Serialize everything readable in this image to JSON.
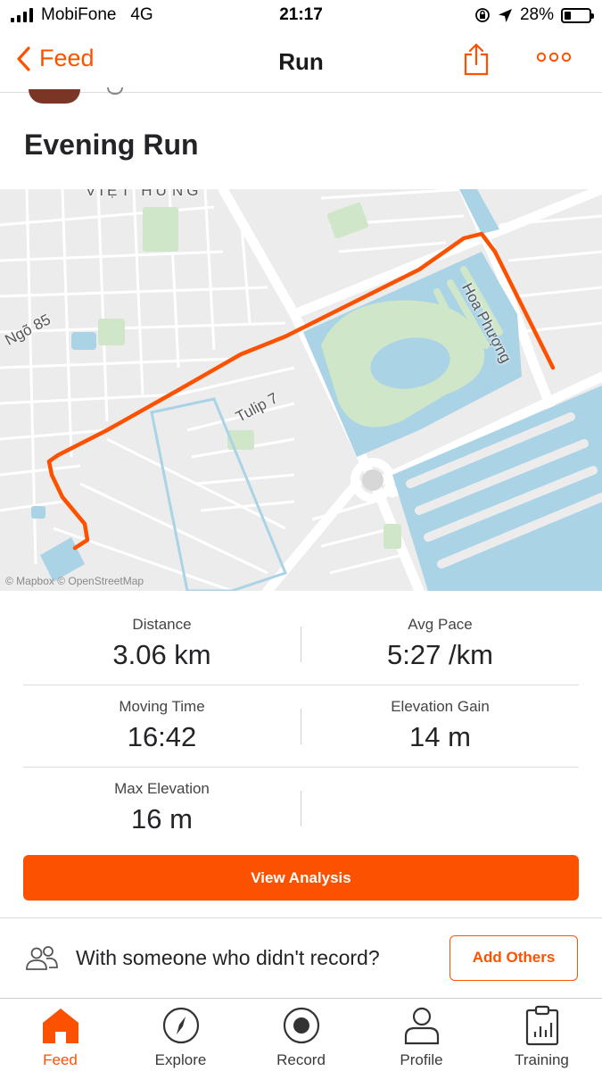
{
  "status_bar": {
    "carrier": "MobiFone",
    "network": "4G",
    "time": "21:17",
    "battery": "28%",
    "battery_level": 0.28
  },
  "nav": {
    "back_label": "Feed",
    "title": "Run"
  },
  "activity": {
    "title": "Evening Run"
  },
  "map": {
    "labels": {
      "district": "VIỆT HƯNG",
      "street1": "Ngõ 85",
      "street2": "Tulip 7",
      "street3": "Hoa Phượng"
    },
    "attribution": "© Mapbox © OpenStreetMap",
    "route_color": "#fc5200"
  },
  "stats": [
    {
      "label": "Distance",
      "value": "3.06 km"
    },
    {
      "label": "Avg Pace",
      "value": "5:27 /km"
    },
    {
      "label": "Moving Time",
      "value": "16:42"
    },
    {
      "label": "Elevation Gain",
      "value": "14 m"
    },
    {
      "label": "Max Elevation",
      "value": "16 m"
    }
  ],
  "actions": {
    "view_analysis": "View Analysis",
    "with_prompt": "With someone who didn't record?",
    "add_others": "Add Others"
  },
  "tabs": [
    {
      "label": "Feed",
      "icon": "home-icon",
      "active": true
    },
    {
      "label": "Explore",
      "icon": "compass-icon",
      "active": false
    },
    {
      "label": "Record",
      "icon": "record-icon",
      "active": false
    },
    {
      "label": "Profile",
      "icon": "person-icon",
      "active": false
    },
    {
      "label": "Training",
      "icon": "clipboard-chart-icon",
      "active": false
    }
  ],
  "colors": {
    "accent": "#fc5200",
    "text": "#242428",
    "water": "#aad3e6",
    "park": "#cde8c8"
  }
}
